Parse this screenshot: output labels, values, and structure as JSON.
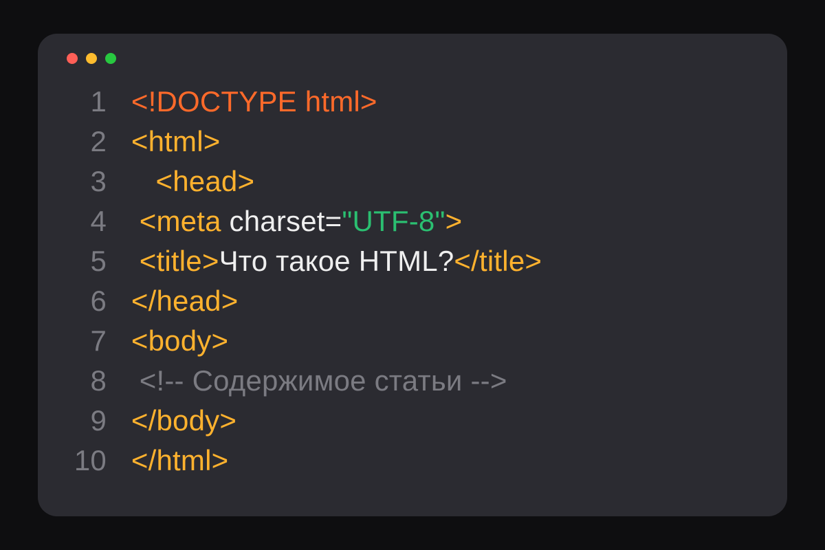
{
  "traffic_lights": {
    "red": "#ff5f57",
    "yellow": "#febc2e",
    "green": "#28c840"
  },
  "colors": {
    "bg_outer": "#0e0e10",
    "bg_window": "#2b2b31",
    "line_number": "#7b7b82",
    "doctype": "#ff6a2a",
    "tag": "#ffb22e",
    "attr": "#efefef",
    "string": "#2bbf71",
    "text": "#efefef",
    "comment": "#7b7b82"
  },
  "lines": {
    "1": {
      "num": "1"
    },
    "2": {
      "num": "2"
    },
    "3": {
      "num": "3"
    },
    "4": {
      "num": "4"
    },
    "5": {
      "num": "5"
    },
    "6": {
      "num": "6"
    },
    "7": {
      "num": "7"
    },
    "8": {
      "num": "8"
    },
    "9": {
      "num": "9"
    },
    "10": {
      "num": "10"
    }
  },
  "tokens": {
    "doctype": "<!DOCTYPE html>",
    "html_open": "<html>",
    "head_open": "<head>",
    "meta_open": "<meta",
    "meta_attr": " charset=",
    "meta_val": "\"UTF-8\"",
    "meta_close": ">",
    "title_open": "<title>",
    "title_text": "Что такое HTML?",
    "title_close": "</title>",
    "head_close": "</head>",
    "body_open": "<body>",
    "comment": "<!-- Содержимое статьи -->",
    "body_close": "</body>",
    "html_close": "</html>"
  },
  "indent": {
    "none": "",
    "pad_small": " ",
    "pad_head": "    ",
    "pad_meta": "  ",
    "pad_title": "  ",
    "pad_comment": "  "
  }
}
